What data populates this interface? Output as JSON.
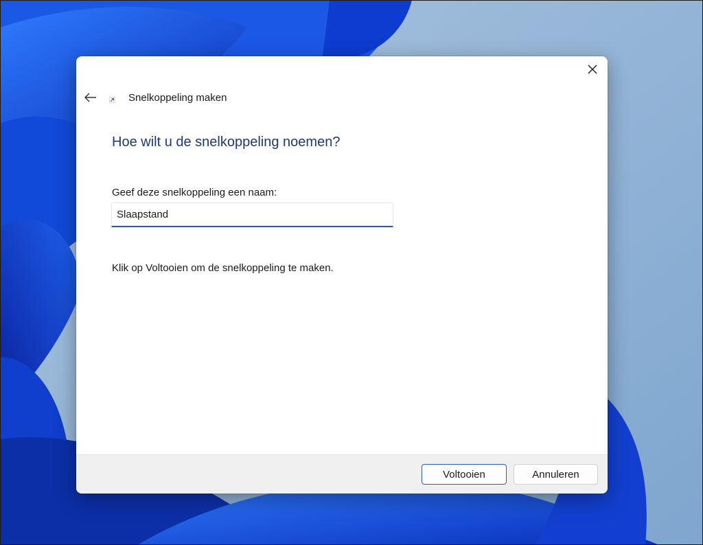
{
  "dialog": {
    "title": "Snelkoppeling maken",
    "heading": "Hoe wilt u de snelkoppeling noemen?",
    "field_label": "Geef deze snelkoppeling een naam:",
    "name_value": "Slaapstand",
    "instruction": "Klik op Voltooien om de snelkoppeling te maken.",
    "buttons": {
      "finish": "Voltooien",
      "cancel": "Annuleren"
    },
    "icons": {
      "back": "back-arrow-icon",
      "close": "close-icon",
      "shortcut": "shortcut-arrow-icon"
    }
  },
  "colors": {
    "heading": "#1e3a6e",
    "accent": "#1f5bb5",
    "footer": "#f0f0f0",
    "wallpaper_blue": "#1a56d6"
  }
}
